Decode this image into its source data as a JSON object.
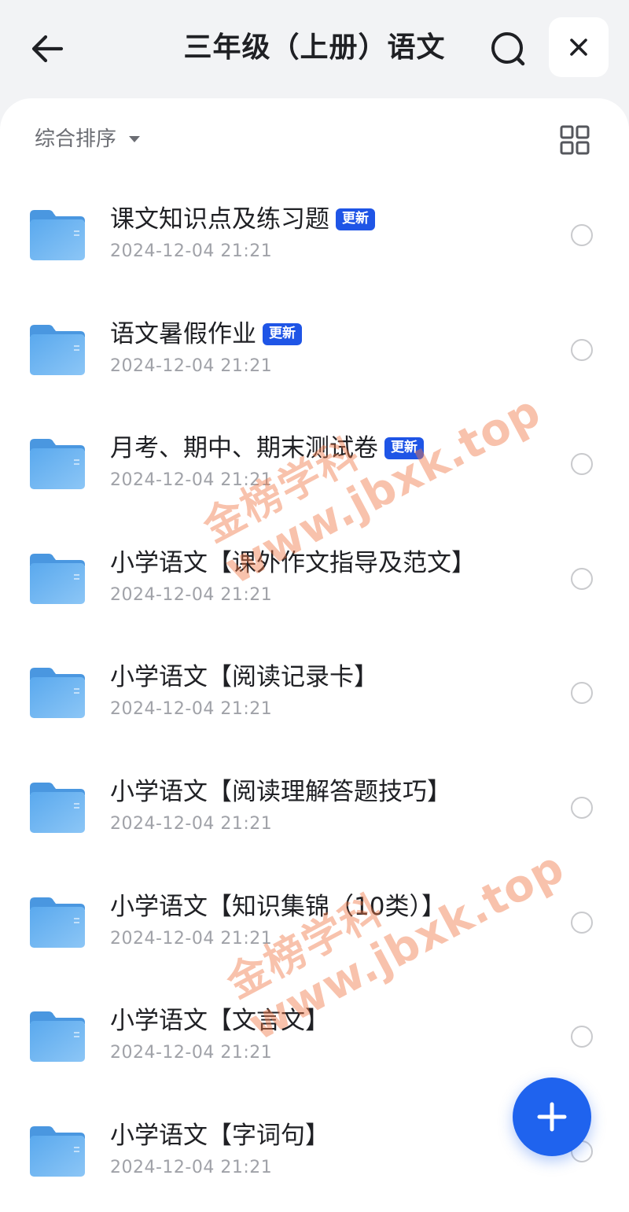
{
  "header": {
    "title": "三年级（上册）语文",
    "back_icon": "arrow-left-icon",
    "search_icon": "search-icon",
    "close_icon": "close-icon"
  },
  "toolbar": {
    "sort_label": "综合排序",
    "grid_icon": "grid-view-icon"
  },
  "badge_label": "更新",
  "items": [
    {
      "name": "课文知识点及练习题",
      "date": "2024-12-04 21:21",
      "updated": true
    },
    {
      "name": "语文暑假作业",
      "date": "2024-12-04 21:21",
      "updated": true
    },
    {
      "name": "月考、期中、期末测试卷",
      "date": "2024-12-04 21:21",
      "updated": true
    },
    {
      "name": "小学语文【课外作文指导及范文】",
      "date": "2024-12-04 21:21",
      "updated": false
    },
    {
      "name": "小学语文【阅读记录卡】",
      "date": "2024-12-04 21:21",
      "updated": false
    },
    {
      "name": "小学语文【阅读理解答题技巧】",
      "date": "2024-12-04 21:21",
      "updated": false
    },
    {
      "name": "小学语文【知识集锦（10类）】",
      "date": "2024-12-04 21:21",
      "updated": false
    },
    {
      "name": "小学语文【文言文】",
      "date": "2024-12-04 21:21",
      "updated": false
    },
    {
      "name": "小学语文【字词句】",
      "date": "2024-12-04 21:21",
      "updated": false
    }
  ],
  "fab": {
    "icon": "plus-icon"
  },
  "watermarks": [
    {
      "line1": "金榜学科",
      "line2": "www.jbxk.top"
    },
    {
      "line1": "金榜学科",
      "line2": "www.jbxk.top"
    }
  ],
  "colors": {
    "accent": "#1f55e6",
    "fab": "#1f63ee",
    "folder": "#5aa9ee",
    "watermark": "#f07846"
  }
}
